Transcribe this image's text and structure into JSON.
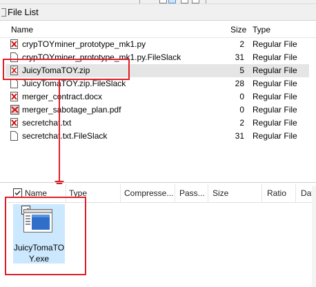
{
  "window": {
    "title": "File List"
  },
  "file_list": {
    "columns": {
      "name": "Name",
      "size": "Size",
      "type": "Type"
    },
    "rows": [
      {
        "name": "crypTOYminer_prototype_mk1.py",
        "size": "2",
        "type": "Regular File",
        "icon": "deleted-file-icon"
      },
      {
        "name": "crypTOYminer_prototype_mk1.py.FileSlack",
        "size": "31",
        "type": "Regular File",
        "icon": "file-icon"
      },
      {
        "name": "JuicyTomaTOY.zip",
        "size": "5",
        "type": "Regular File",
        "icon": "zip-deleted-file-icon",
        "selected": true
      },
      {
        "name": "JuicyTomaTOY.zip.FileSlack",
        "size": "28",
        "type": "Regular File",
        "icon": "file-icon"
      },
      {
        "name": "merger_contract.docx",
        "size": "0",
        "type": "Regular File",
        "icon": "deleted-file-icon"
      },
      {
        "name": "merger_sabotage_plan.pdf",
        "size": "0",
        "type": "Regular File",
        "icon": "deleted-picture-file-icon"
      },
      {
        "name": "secretchat.txt",
        "size": "2",
        "type": "Regular File",
        "icon": "deleted-file-icon"
      },
      {
        "name": "secretchat.txt.FileSlack",
        "size": "31",
        "type": "Regular File",
        "icon": "file-icon"
      }
    ]
  },
  "zip_view": {
    "columns": {
      "name": "Name",
      "type": "Type",
      "compressed": "Compresse...",
      "password": "Pass...",
      "size": "Size",
      "ratio": "Ratio",
      "date": "Date"
    },
    "items": [
      {
        "name": "JuicyTomaTOY.exe",
        "checked": true,
        "icon": "exe-window-icon"
      }
    ]
  },
  "colors": {
    "annotation_red": "#e01b24",
    "selection_blue": "#cce8ff",
    "row_selected_gray": "#e5e5e5"
  }
}
